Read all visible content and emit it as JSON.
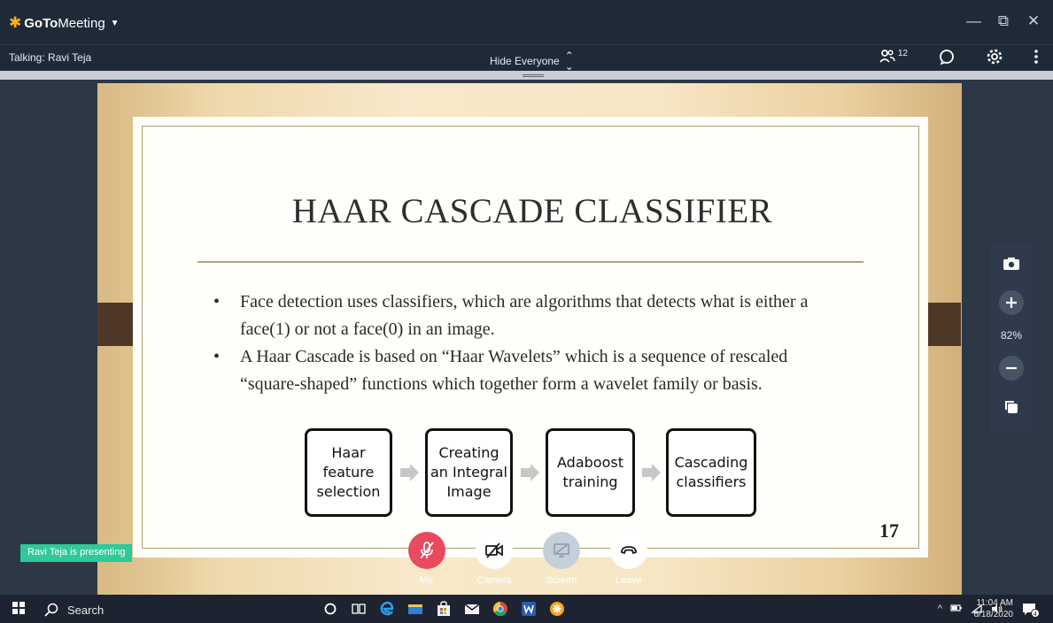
{
  "app": {
    "brand_prefix": "GoTo",
    "brand_suffix": "Meeting",
    "logo_icon": "gotomeeting-star-icon"
  },
  "window_controls": {
    "minimize": "—",
    "restore": "⧉",
    "close": "✕"
  },
  "toolbar": {
    "talking": "Talking: Ravi Teja",
    "view_mode": "Hide Everyone",
    "attendee_count": "12"
  },
  "slide": {
    "title": "HAAR CASCADE CLASSIFIER",
    "bullets": [
      "Face detection uses classifiers, which are algorithms that detects what is either a face(1) or not a face(0) in an image.",
      "A Haar Cascade is based on “Haar Wavelets” which is a  sequence of rescaled “square-shaped” functions which together form a wavelet family or basis."
    ],
    "flow_steps": [
      "Haar feature selection",
      "Creating an Integral Image",
      "Adaboost training",
      "Cascading classifiers"
    ],
    "page_number": "17"
  },
  "zoom": {
    "level": "82%"
  },
  "presenter_badge": "Ravi Teja is presenting",
  "controls": {
    "mic": "Mic",
    "camera": "Camera",
    "screen": "Screen",
    "leave": "Leave"
  },
  "taskbar": {
    "search": "Search",
    "time": "11:04 AM",
    "date": "6/18/2020",
    "notifications": "4"
  },
  "colors": {
    "title_bar": "#1f2a38",
    "mic_muted": "#e84a5f",
    "presenting_badge": "#2fc99a",
    "taskbar": "#1d2330"
  }
}
